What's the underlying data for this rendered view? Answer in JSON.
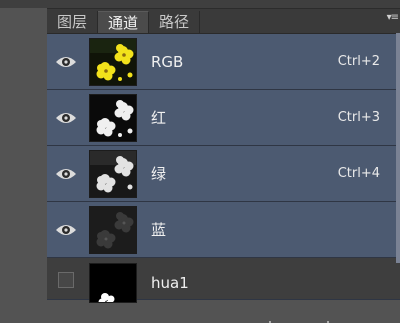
{
  "tabs": [
    {
      "label": "图层",
      "active": false
    },
    {
      "label": "通道",
      "active": true
    },
    {
      "label": "路径",
      "active": false
    }
  ],
  "panel_menu_icon": "panel-menu-icon",
  "channels": [
    {
      "name": "RGB",
      "shortcut": "Ctrl+2",
      "visible": true,
      "selected": true,
      "thumb": "composite-flower"
    },
    {
      "name": "红",
      "shortcut": "Ctrl+3",
      "visible": true,
      "selected": true,
      "thumb": "red-channel-flower"
    },
    {
      "name": "绿",
      "shortcut": "Ctrl+4",
      "visible": true,
      "selected": true,
      "thumb": "green-channel-flower"
    },
    {
      "name": "蓝",
      "shortcut": "",
      "visible": true,
      "selected": true,
      "thumb": "blue-channel-flower"
    },
    {
      "name": "hua1",
      "shortcut": "",
      "visible": false,
      "selected": false,
      "thumb": "alpha-mask"
    }
  ],
  "colors": {
    "selected_row": "#4c5a71",
    "panel_bg": "#3d3d3d",
    "app_bg": "#535353"
  }
}
